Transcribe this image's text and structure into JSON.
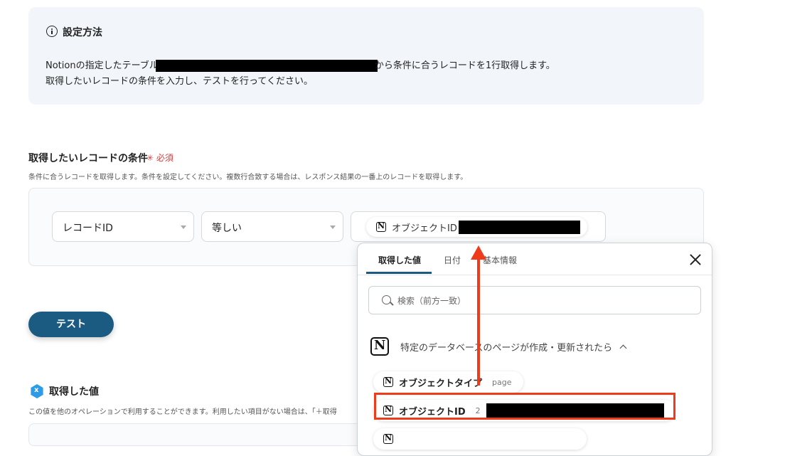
{
  "info": {
    "title": "設定方法",
    "line1_before": "Notionの指定したテーブル",
    "line1_after": "から条件に合うレコードを1行取得します。",
    "line2": "取得したいレコードの条件を入力し、テストを行ってください。"
  },
  "condition": {
    "title": "取得したいレコードの条件",
    "required": "✳ 必須",
    "description": "条件に合うレコードを取得します。条件を設定してください。複数行合致する場合は、レスポンス結果の一番上のレコードを取得します。",
    "field_select": "レコードID",
    "operator_select": "等しい",
    "value_chip_label": "オブジェクトID"
  },
  "test_button": "テスト",
  "output": {
    "title": "取得した値",
    "description": "この値を他のオペレーションで利用することができます。利用したい項目がない場合は、「＋取得"
  },
  "popup": {
    "tabs": [
      "取得した値",
      "日付",
      "基本情報"
    ],
    "search_placeholder": "検索（前方一致）",
    "group_label": "特定のデータベースのページが作成・更新されたら",
    "items": [
      {
        "name": "オブジェクトタイプ",
        "value": "page"
      },
      {
        "name": "オブジェクトID",
        "value": "2"
      }
    ]
  },
  "colors": {
    "primary": "#1b5b82",
    "annotation": "#ee3b1c",
    "required": "#e03a3a"
  }
}
